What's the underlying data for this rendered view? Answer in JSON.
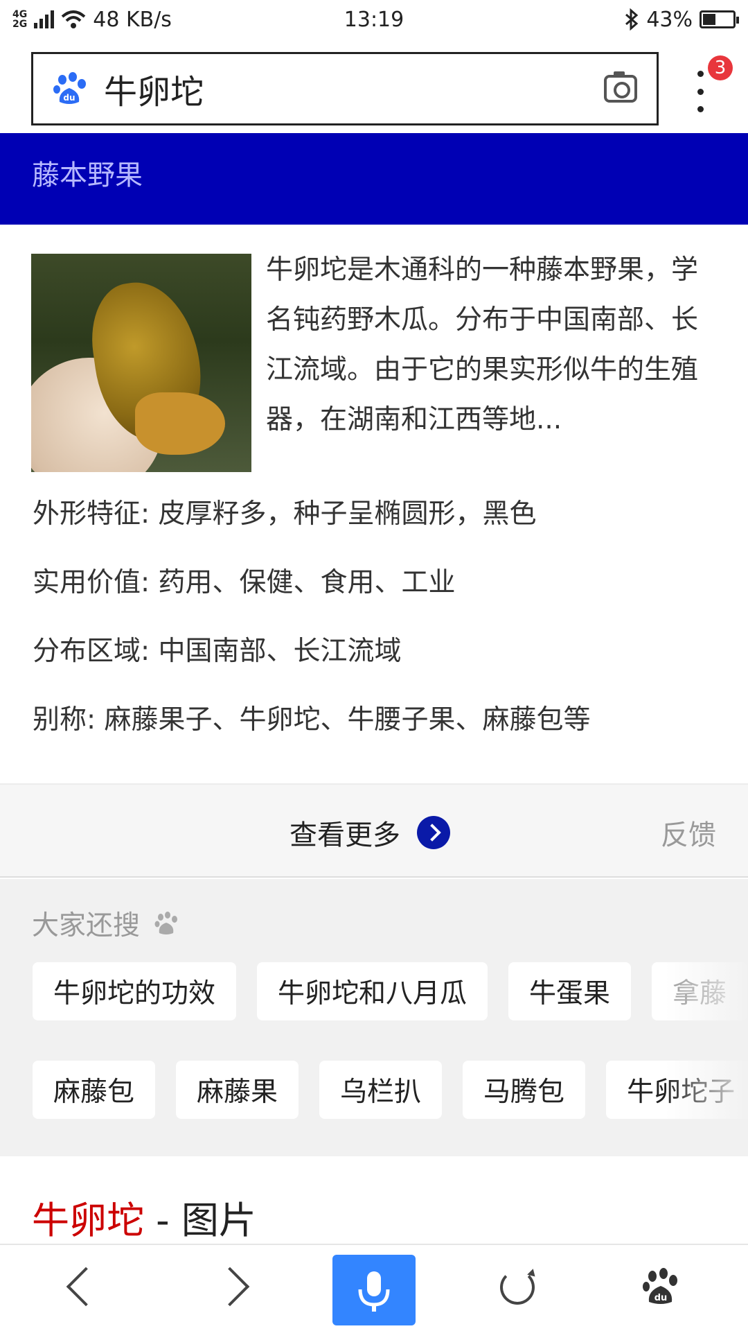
{
  "status_bar": {
    "network_type_top": "4G",
    "network_type_bottom": "2G",
    "speed": "48 KB/s",
    "time": "13:19",
    "battery": "43%",
    "battery_level": 0.43
  },
  "search": {
    "query": "牛卵坨",
    "badge_count": "3"
  },
  "header_band": {
    "subtitle": "藤本野果"
  },
  "summary": {
    "text": "牛卵坨是木通科的一种藤本野果，学名钝药野木瓜。分布于中国南部、长江流域。由于它的果实形似牛的生殖器，在湖南和江西等地..."
  },
  "attributes": [
    {
      "label": "外形特征:",
      "value": "皮厚籽多，种子呈椭圆形，黑色"
    },
    {
      "label": "实用价值:",
      "value": "药用、保健、食用、工业"
    },
    {
      "label": "分布区域:",
      "value": "中国南部、长江流域"
    },
    {
      "label": "别称:",
      "value": "麻藤果子、牛卵坨、牛腰子果、麻藤包等"
    }
  ],
  "more": {
    "label": "查看更多",
    "feedback": "反馈"
  },
  "related": {
    "title": "大家还搜",
    "row1": [
      "牛卵坨的功效",
      "牛卵坨和八月瓜",
      "牛蛋果",
      "拿藤"
    ],
    "row2": [
      "麻藤包",
      "麻藤果",
      "乌栏扒",
      "马腾包",
      "牛卵坨子"
    ]
  },
  "images_section": {
    "keyword": "牛卵坨",
    "suffix": " - 图片"
  }
}
